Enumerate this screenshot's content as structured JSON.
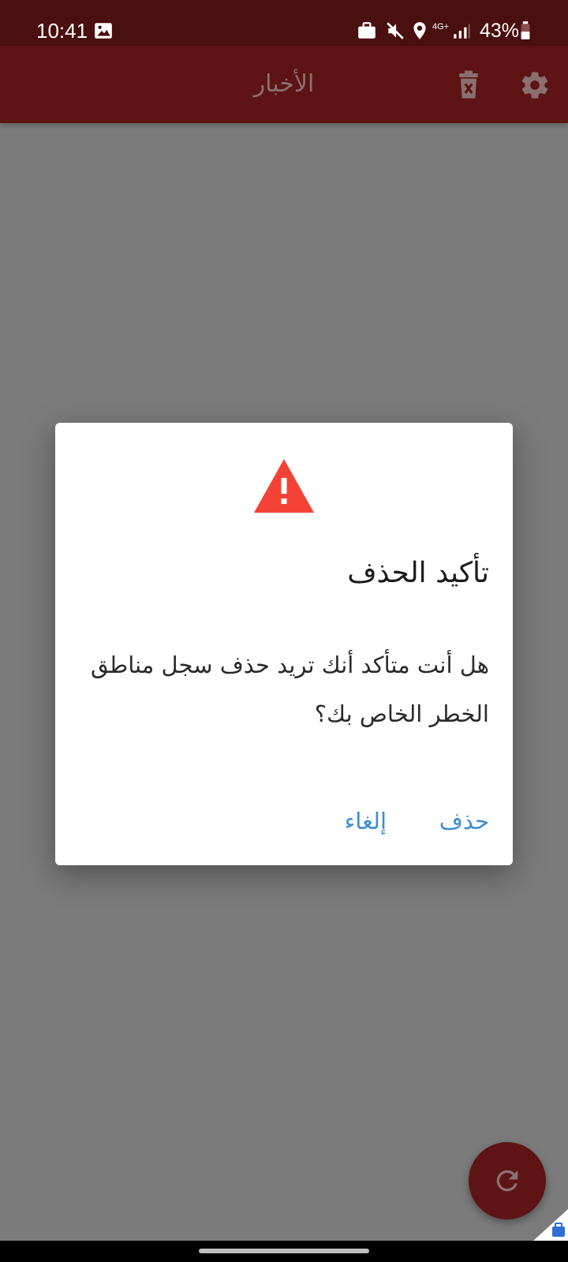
{
  "status_bar": {
    "time": "10:41",
    "battery": "43%",
    "network": "4G+",
    "icons": [
      "gallery-icon",
      "work-profile-icon",
      "mute-icon",
      "location-icon",
      "signal-icon",
      "battery-icon"
    ]
  },
  "app_bar": {
    "title": "الأخبار",
    "icons": [
      "delete-icon",
      "settings-icon"
    ],
    "background_color": "#5e1414"
  },
  "dialog": {
    "icon": "warning-icon",
    "icon_color": "#f44336",
    "title": "تأكيد الحذف",
    "message": "هل أنت متأكد أنك تريد حذف سجل مناطق الخطر الخاص بك؟",
    "delete_label": "حذف",
    "cancel_label": "إلغاء",
    "action_color": "#3a8fd0"
  },
  "fab": {
    "icon": "refresh-icon"
  }
}
